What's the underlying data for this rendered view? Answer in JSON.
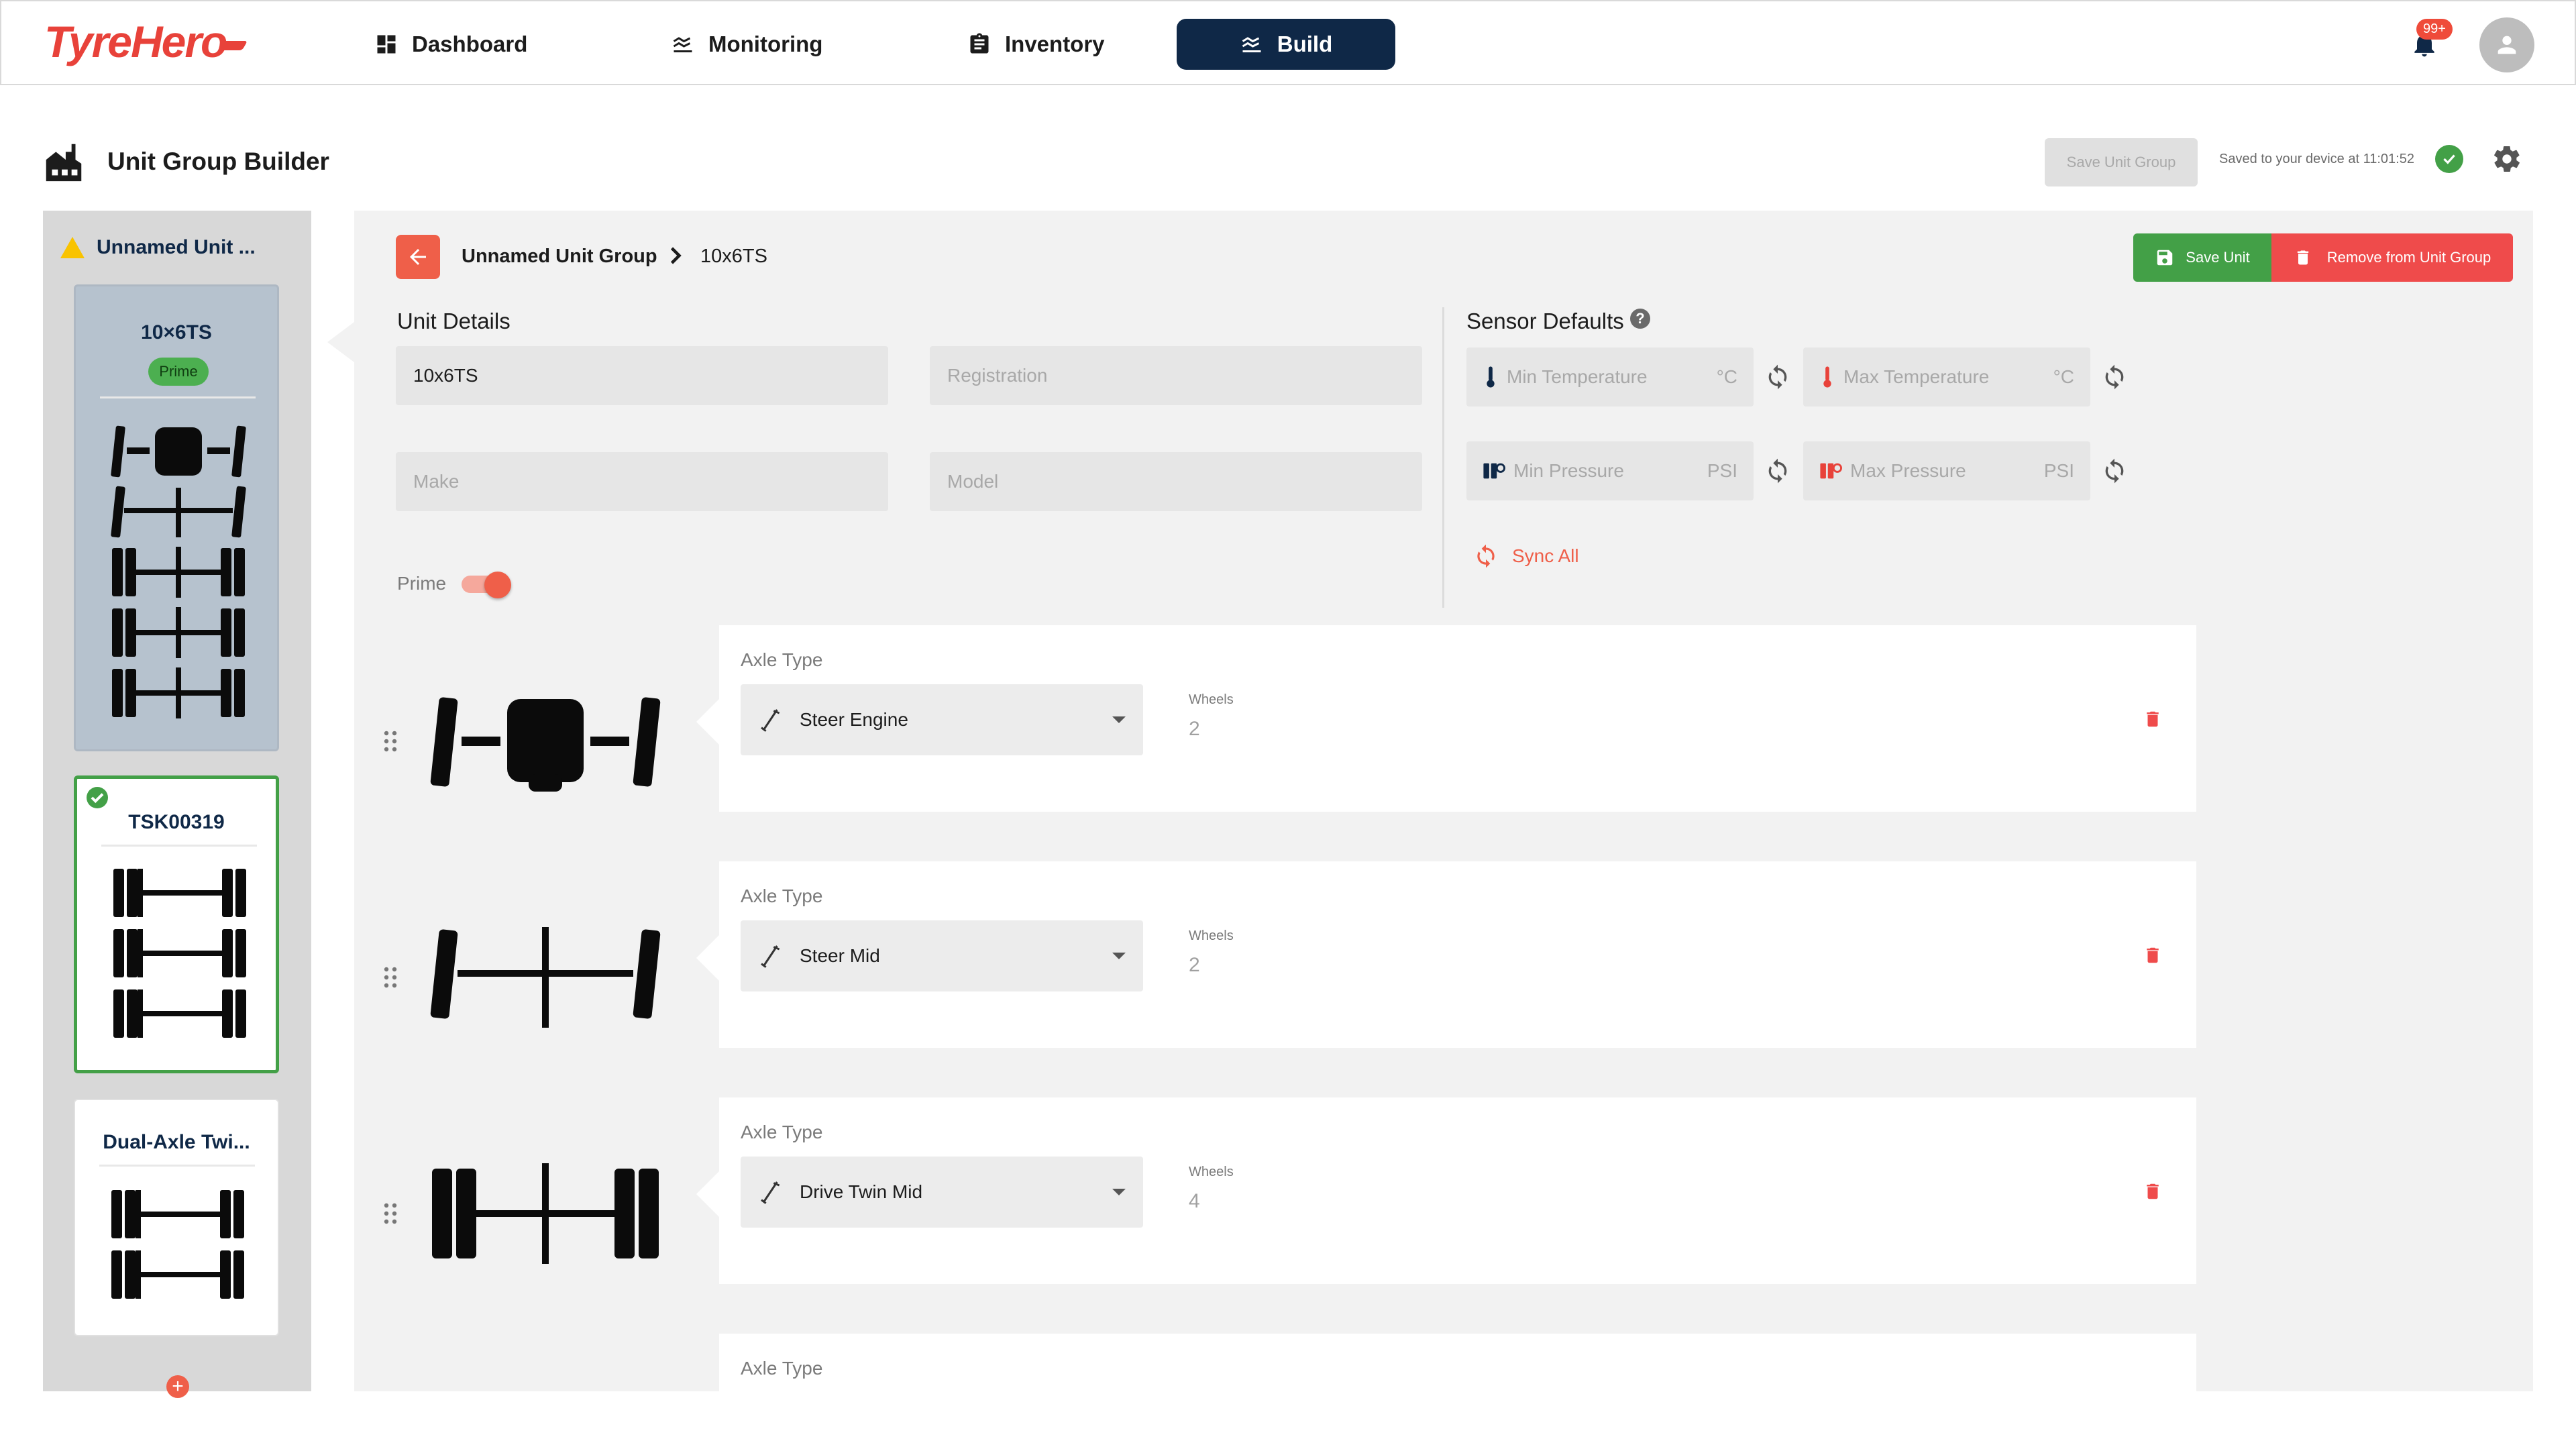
{
  "app": {
    "logo": "TyreHero"
  },
  "nav": {
    "items": [
      {
        "label": "Dashboard",
        "icon": "dashboard-icon"
      },
      {
        "label": "Monitoring",
        "icon": "monitoring-icon"
      },
      {
        "label": "Inventory",
        "icon": "clipboard-icon"
      },
      {
        "label": "Build",
        "icon": "build-icon",
        "active": true
      }
    ],
    "notification_badge": "99+"
  },
  "page": {
    "title": "Unit Group Builder",
    "save_group_label": "Save Unit Group",
    "saved_status": "Saved to your device at 11:01:52"
  },
  "sidebar": {
    "group_name": "Unnamed Unit ...",
    "cards": [
      {
        "title": "10×6TS",
        "badge": "Prime",
        "selected": true
      },
      {
        "title": "TSK00319",
        "valid": true
      },
      {
        "title": "Dual-Axle Twi..."
      }
    ]
  },
  "breadcrumb": {
    "group": "Unnamed Unit Group",
    "unit": "10x6TS"
  },
  "actions": {
    "save_unit": "Save Unit",
    "remove": "Remove from Unit Group"
  },
  "unit_details": {
    "heading": "Unit Details",
    "name_value": "10x6TS",
    "registration_placeholder": "Registration",
    "make_placeholder": "Make",
    "model_placeholder": "Model",
    "prime_label": "Prime",
    "prime_on": true
  },
  "sensor_defaults": {
    "heading": "Sensor Defaults",
    "min_temp": "Min Temperature",
    "max_temp": "Max Temperature",
    "temp_unit": "°C",
    "min_pressure": "Min Pressure",
    "max_pressure": "Max Pressure",
    "pressure_unit": "PSI",
    "sync_all": "Sync All"
  },
  "axles": [
    {
      "label": "Axle Type",
      "type": "Steer Engine",
      "wheels_label": "Wheels",
      "wheels": "2"
    },
    {
      "label": "Axle Type",
      "type": "Steer Mid",
      "wheels_label": "Wheels",
      "wheels": "2"
    },
    {
      "label": "Axle Type",
      "type": "Drive Twin Mid",
      "wheels_label": "Wheels",
      "wheels": "4"
    },
    {
      "label": "Axle Type"
    }
  ],
  "colors": {
    "accent": "#ef5f49",
    "navy": "#0f2847",
    "green": "#43a047",
    "danger": "#ef4b4b"
  }
}
